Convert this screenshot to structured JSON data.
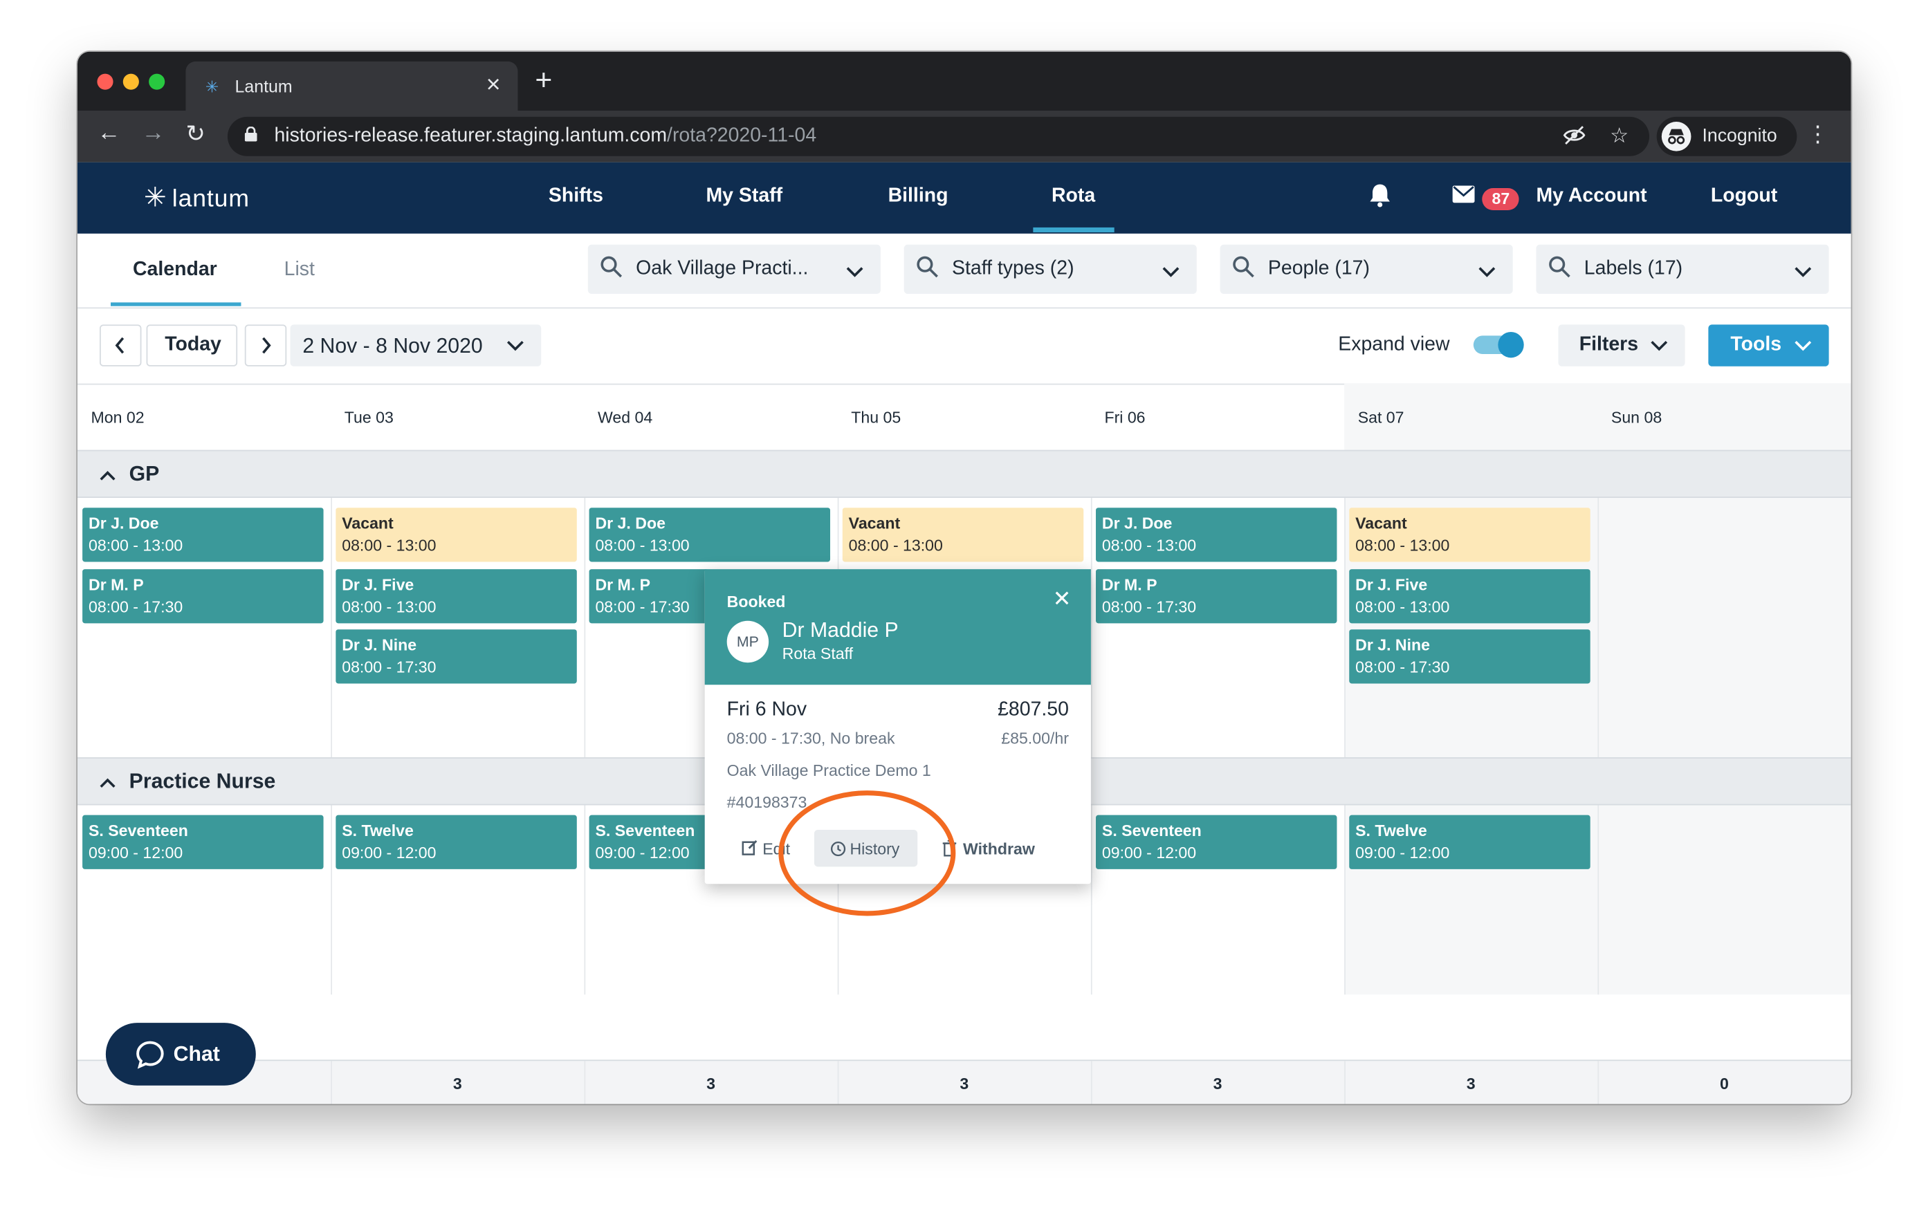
{
  "browser": {
    "tab_title": "Lantum",
    "url_host": "histories-release.featurer.staging.lantum.com",
    "url_path": "/rota?2020-11-04",
    "profile_label": "Incognito"
  },
  "app": {
    "logo": "lantum",
    "nav": [
      "Shifts",
      "My Staff",
      "Billing",
      "Rota"
    ],
    "active_nav": "Rota",
    "mail_count": "87",
    "account_label": "My Account",
    "logout_label": "Logout"
  },
  "view_tabs": [
    "Calendar",
    "List"
  ],
  "filters": [
    {
      "label": "Oak Village Practi..."
    },
    {
      "label": "Staff types (2)"
    },
    {
      "label": "People (17)"
    },
    {
      "label": "Labels (17)"
    }
  ],
  "toolbar": {
    "today_label": "Today",
    "date_range": "2 Nov - 8 Nov 2020",
    "expand_label": "Expand view",
    "expand_on": true,
    "filters_label": "Filters",
    "tools_label": "Tools"
  },
  "days": [
    "Mon 02",
    "Tue 03",
    "Wed 04",
    "Thu 05",
    "Fri 06",
    "Sat 07",
    "Sun 08"
  ],
  "groups": [
    {
      "title": "GP",
      "shifts": [
        {
          "name": "Dr J. Doe",
          "time": "08:00 - 13:00",
          "status": "booked",
          "day": 0,
          "slot": 0
        },
        {
          "name": "Dr M. P",
          "time": "08:00 - 17:30",
          "status": "booked",
          "day": 0,
          "slot": 1
        },
        {
          "name": "Vacant",
          "time": "08:00 - 13:00",
          "status": "vacant",
          "day": 1,
          "slot": 0
        },
        {
          "name": "Dr J. Five",
          "time": "08:00 - 13:00",
          "status": "booked",
          "day": 1,
          "slot": 1
        },
        {
          "name": "Dr J. Nine",
          "time": "08:00 - 17:30",
          "status": "booked",
          "day": 1,
          "slot": 2
        },
        {
          "name": "Dr J. Doe",
          "time": "08:00 - 13:00",
          "status": "booked",
          "day": 2,
          "slot": 0
        },
        {
          "name": "Dr M. P",
          "time": "08:00 - 17:30",
          "status": "booked",
          "day": 2,
          "slot": 1
        },
        {
          "name": "Vacant",
          "time": "08:00 - 13:00",
          "status": "vacant",
          "day": 3,
          "slot": 0
        },
        {
          "name": "Dr J. Doe",
          "time": "08:00 - 13:00",
          "status": "booked",
          "day": 4,
          "slot": 0
        },
        {
          "name": "Dr M. P",
          "time": "08:00 - 17:30",
          "status": "booked",
          "day": 4,
          "slot": 1
        },
        {
          "name": "Vacant",
          "time": "08:00 - 13:00",
          "status": "vacant",
          "day": 5,
          "slot": 0
        },
        {
          "name": "Dr J. Five",
          "time": "08:00 - 13:00",
          "status": "booked",
          "day": 5,
          "slot": 1
        },
        {
          "name": "Dr J. Nine",
          "time": "08:00 - 17:30",
          "status": "booked",
          "day": 5,
          "slot": 2
        }
      ]
    },
    {
      "title": "Practice Nurse",
      "shifts": [
        {
          "name": "S. Seventeen",
          "time": "09:00 - 12:00",
          "status": "booked",
          "day": 0,
          "slot": 0
        },
        {
          "name": "S. Twelve",
          "time": "09:00 - 12:00",
          "status": "booked",
          "day": 1,
          "slot": 0
        },
        {
          "name": "S. Seventeen",
          "time": "09:00 - 12:00",
          "status": "booked",
          "day": 2,
          "slot": 0
        },
        {
          "name": "S. Seventeen",
          "time": "09:00 - 12:00",
          "status": "booked",
          "day": 4,
          "slot": 0
        },
        {
          "name": "S. Twelve",
          "time": "09:00 - 12:00",
          "status": "booked",
          "day": 5,
          "slot": 0
        }
      ]
    }
  ],
  "popover": {
    "status": "Booked",
    "initials": "MP",
    "name": "Dr Maddie P",
    "role": "Rota Staff",
    "date": "Fri 6 Nov",
    "price": "£807.50",
    "times": "08:00 - 17:30, No break",
    "rate": "£85.00/hr",
    "location": "Oak Village Practice Demo 1",
    "reference": "#40198373",
    "actions": [
      "Edit",
      "History",
      "Withdraw"
    ]
  },
  "totals": [
    "3",
    "3",
    "3",
    "3",
    "3",
    "0"
  ],
  "chat_label": "Chat",
  "colors": {
    "navy": "#0f2d50",
    "teal": "#3b999a",
    "vacant": "#fde8b8",
    "accent": "#2a9bd0",
    "badge": "#e84b5b",
    "annotation": "#f26a21"
  }
}
